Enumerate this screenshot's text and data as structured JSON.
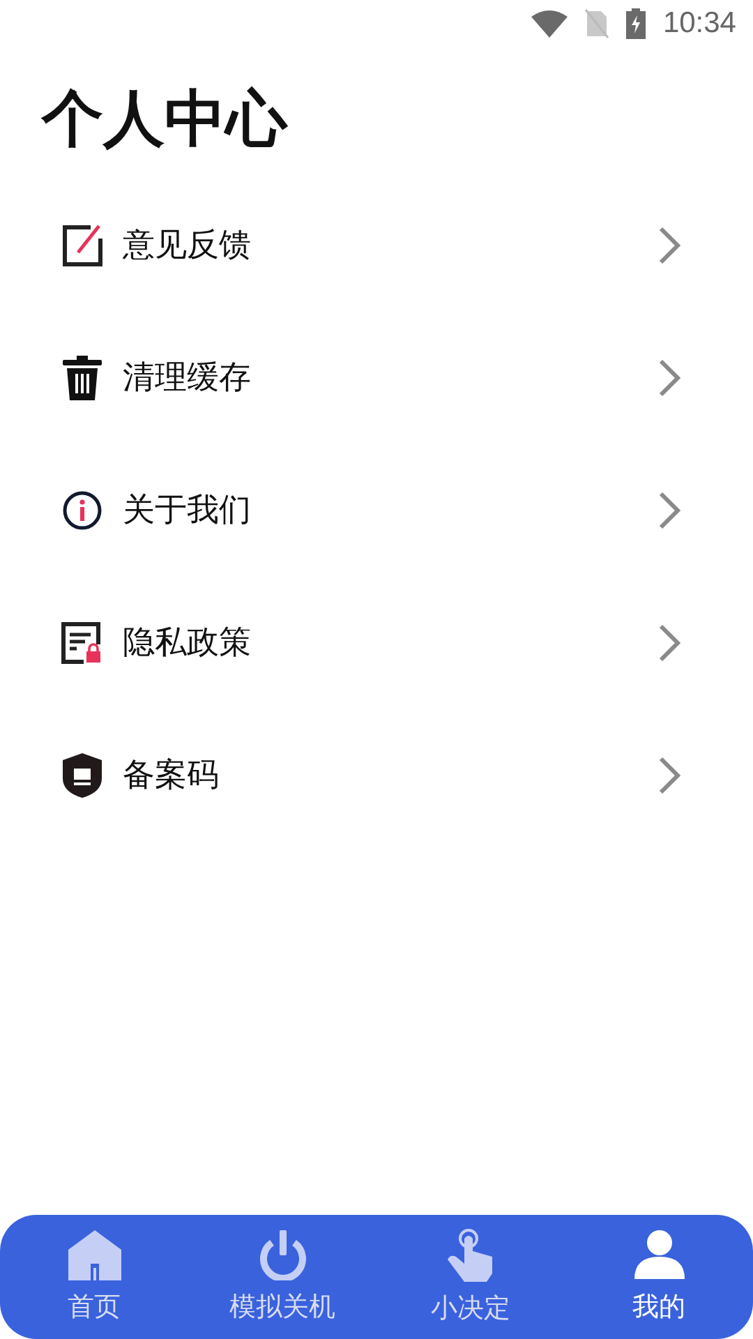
{
  "status_bar": {
    "time": "10:34"
  },
  "title": "个人中心",
  "menu": [
    {
      "kind": "edit",
      "label": "意见反馈"
    },
    {
      "kind": "trash",
      "label": "清理缓存"
    },
    {
      "kind": "info",
      "label": "关于我们"
    },
    {
      "kind": "doc",
      "label": "隐私政策"
    },
    {
      "kind": "shield",
      "label": "备案码"
    }
  ],
  "nav": [
    {
      "kind": "home",
      "label": "首页",
      "selected": false
    },
    {
      "kind": "power",
      "label": "模拟关机",
      "selected": false
    },
    {
      "kind": "tap",
      "label": "小决定",
      "selected": false
    },
    {
      "kind": "user",
      "label": "我的",
      "selected": true
    }
  ]
}
